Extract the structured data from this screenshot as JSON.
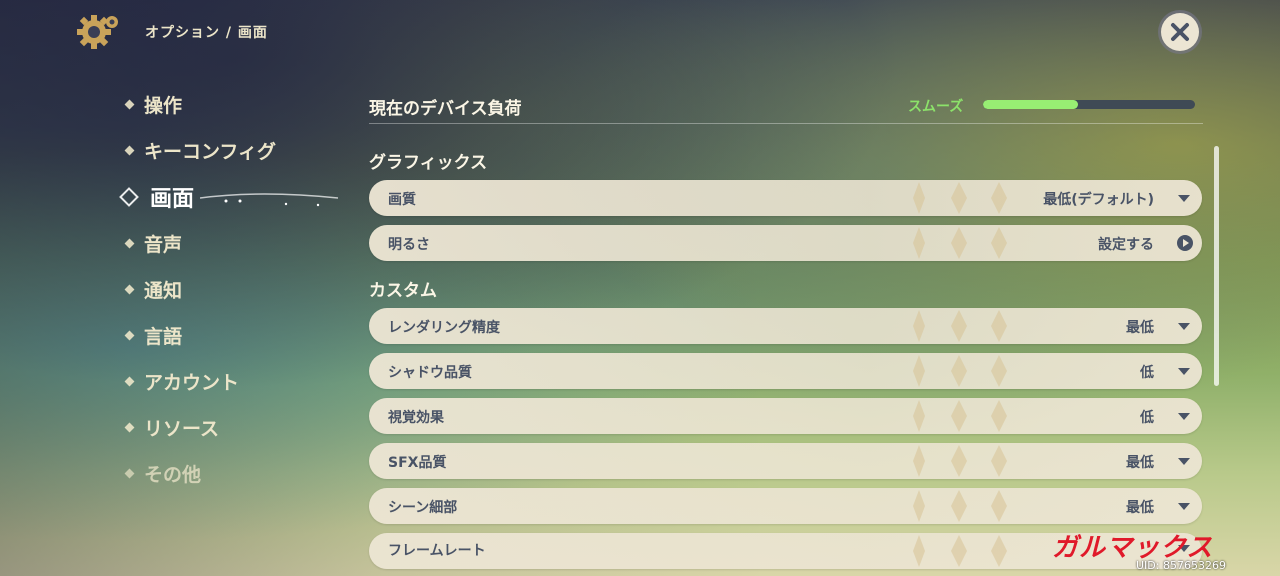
{
  "breadcrumb": "オプション / 画面",
  "sidebar": {
    "items": [
      {
        "label": "操作",
        "active": false
      },
      {
        "label": "キーコンフィグ",
        "active": false
      },
      {
        "label": "画面",
        "active": true
      },
      {
        "label": "音声",
        "active": false
      },
      {
        "label": "通知",
        "active": false
      },
      {
        "label": "言語",
        "active": false
      },
      {
        "label": "アカウント",
        "active": false
      },
      {
        "label": "リソース",
        "active": false
      },
      {
        "label": "その他",
        "active": false
      }
    ]
  },
  "device_load": {
    "title": "現在のデバイス負荷",
    "status": "スムーズ",
    "level": 0.45,
    "color": "#98ee73"
  },
  "graphics": {
    "title": "グラフィックス",
    "rows": [
      {
        "label": "画質",
        "value": "最低(デフォルト)",
        "control": "dropdown"
      },
      {
        "label": "明るさ",
        "value": "設定する",
        "control": "button"
      }
    ]
  },
  "custom": {
    "title": "カスタム",
    "rows": [
      {
        "label": "レンダリング精度",
        "value": "最低",
        "control": "dropdown"
      },
      {
        "label": "シャドウ品質",
        "value": "低",
        "control": "dropdown"
      },
      {
        "label": "視覚効果",
        "value": "低",
        "control": "dropdown"
      },
      {
        "label": "SFX品質",
        "value": "最低",
        "control": "dropdown"
      },
      {
        "label": "シーン細部",
        "value": "最低",
        "control": "dropdown"
      },
      {
        "label": "フレームレート",
        "value": "",
        "control": "dropdown"
      }
    ]
  },
  "watermark": {
    "logo": "ガルマックス",
    "uid": "UID: 857653269"
  },
  "icons": {
    "settings": "gear-icon",
    "close": "close-icon",
    "dropdown": "caret-down-icon",
    "go": "arrow-right-circle-icon"
  },
  "colors": {
    "accent_green": "#98ee73",
    "row_bg": "#ece5d3",
    "row_text": "#495366",
    "header_text": "#ece5c9"
  }
}
